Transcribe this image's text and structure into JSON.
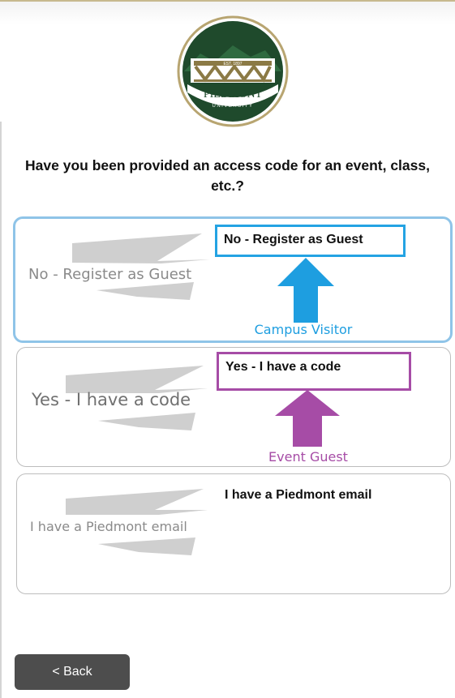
{
  "logo": {
    "est_text": "EST. 1897",
    "name_text": "PIEDMONT",
    "sub_text": "UNIVERSITY"
  },
  "question": "Have you been provided an access code for an event, class, etc.?",
  "options": [
    {
      "graphic_label": "No - Register as Guest",
      "title": "No - Register as Guest",
      "annotation": "Campus Visitor"
    },
    {
      "graphic_label": "Yes - I have a code",
      "title": "Yes - I have a code",
      "annotation": "Event Guest"
    },
    {
      "graphic_label": "I have a Piedmont email",
      "title": "I have a Piedmont email"
    }
  ],
  "back_button_label": "< Back",
  "colors": {
    "selected_border": "#8fc4e8",
    "annotation_blue": "#24a3e3",
    "annotation_purple": "#a64ca6",
    "logo_green": "#1f4a2c",
    "logo_gold": "#b8a571",
    "back_button": "#4d4d4d"
  },
  "icons": {
    "arrow_up_blue": "arrow-up-icon",
    "arrow_up_purple": "arrow-up-icon"
  }
}
